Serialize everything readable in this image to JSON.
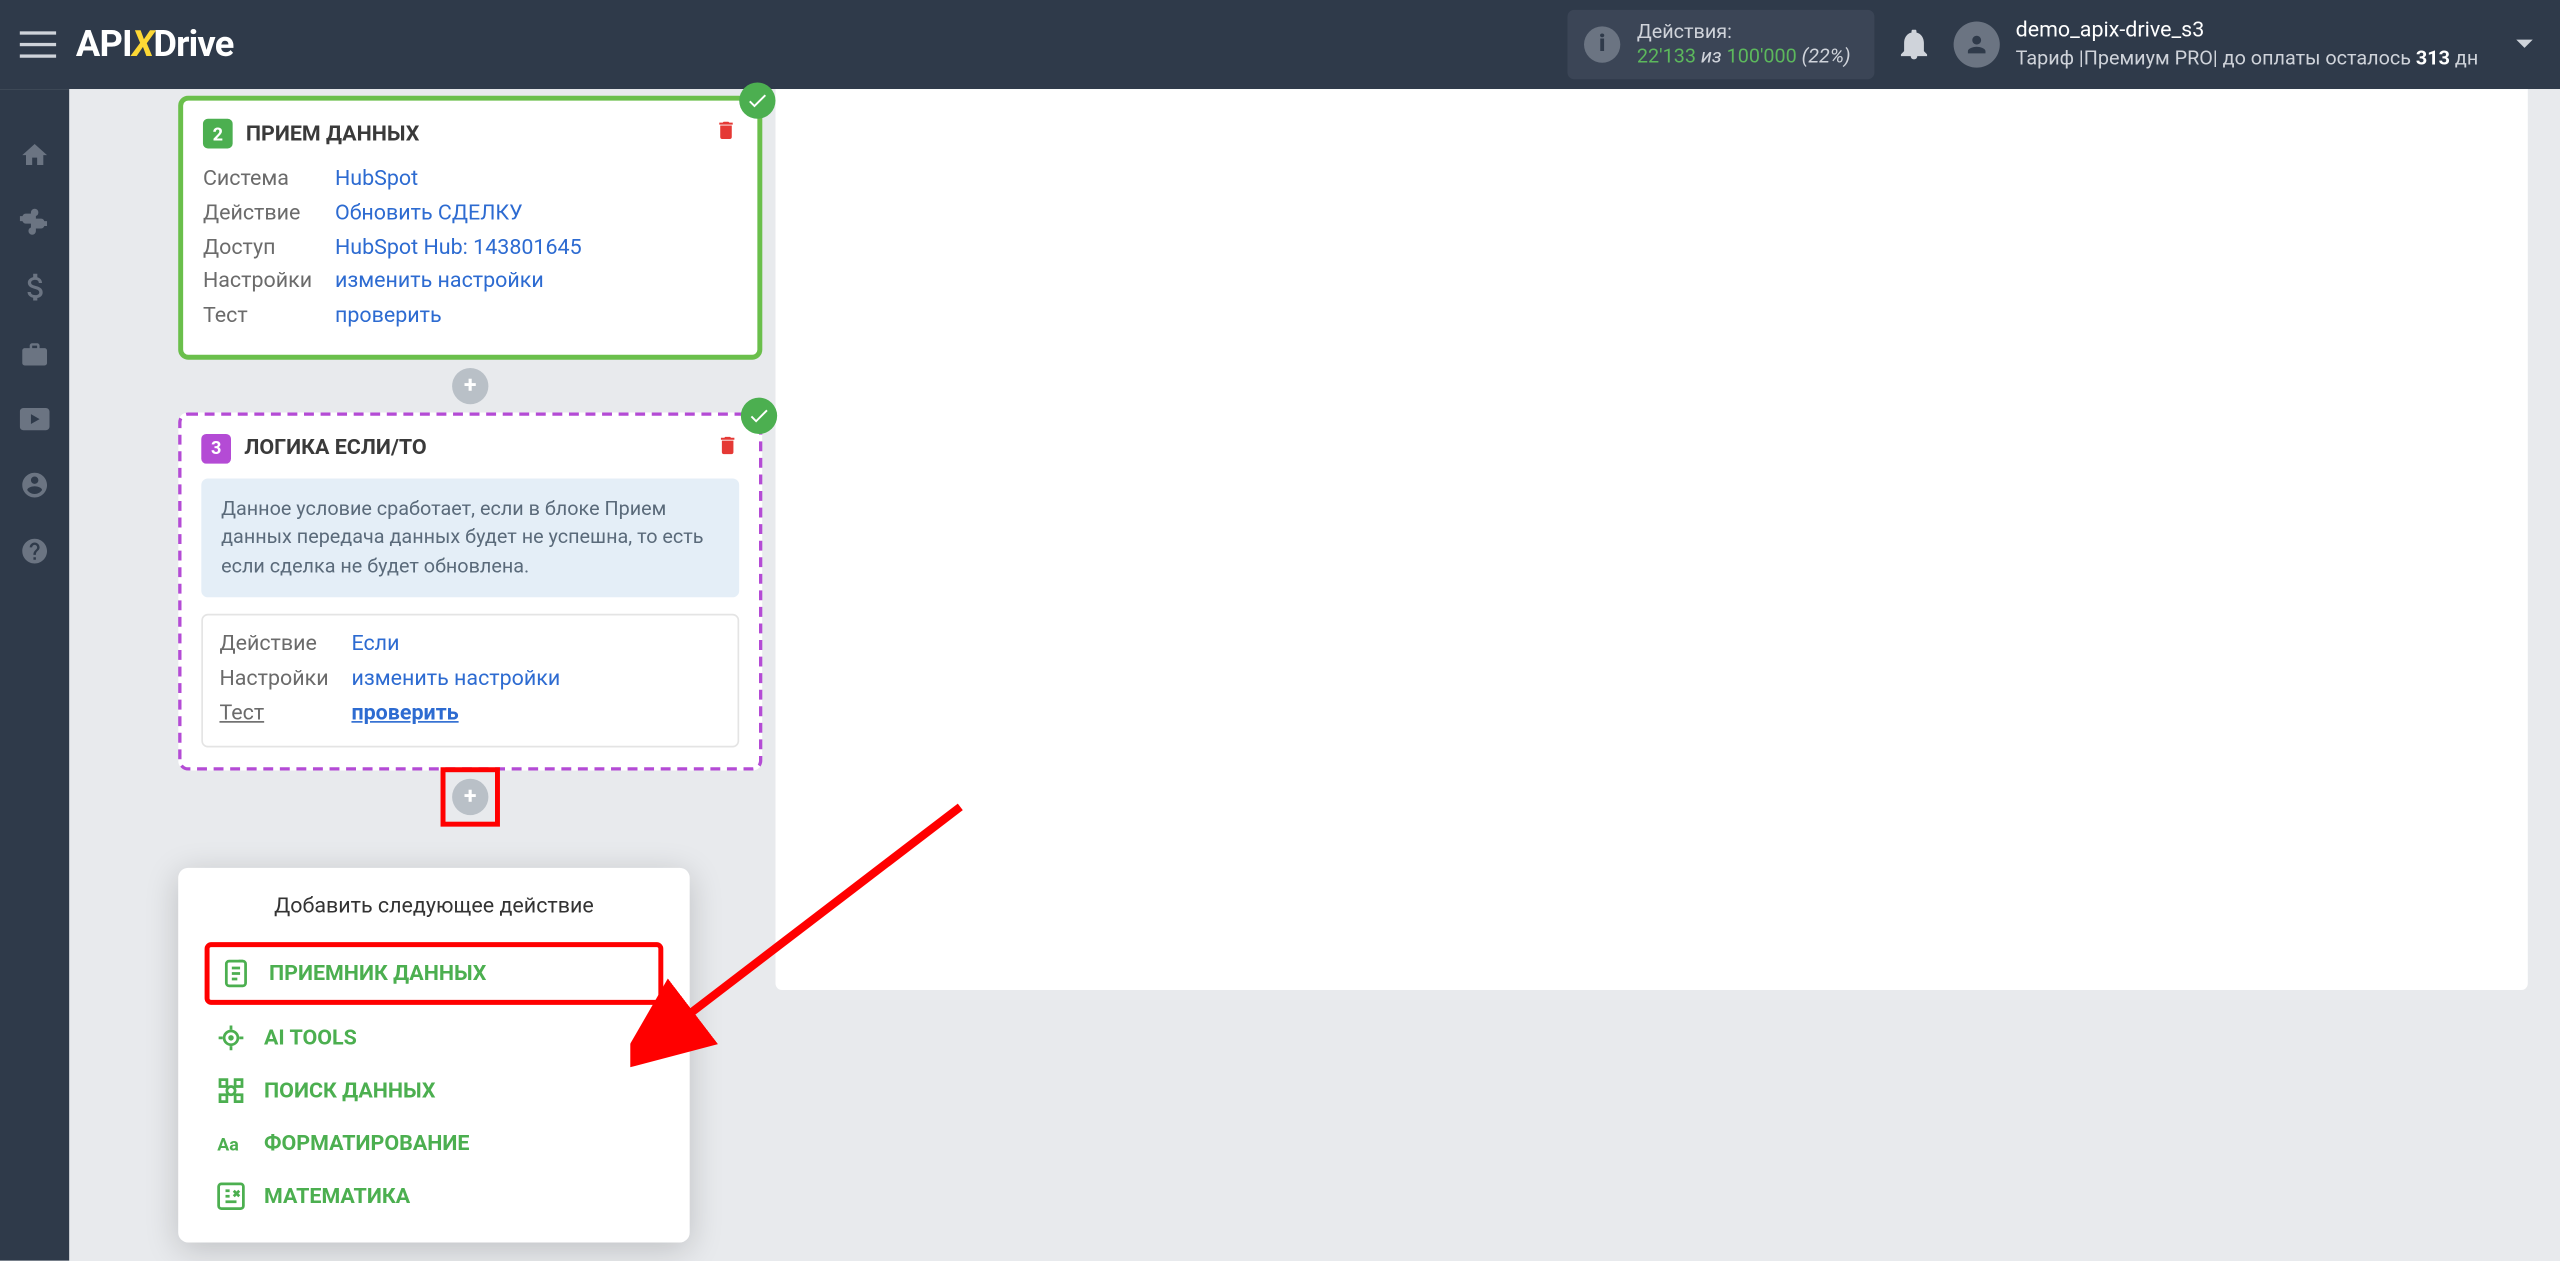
{
  "header": {
    "logo_part1": "API",
    "logo_part2": "X",
    "logo_part3": "Drive",
    "actions_label": "Действия:",
    "actions_used": "22'133",
    "actions_iz": "из",
    "actions_total": "100'000",
    "actions_percent": "(22%)",
    "username": "demo_apix-drive_s3",
    "tariff_prefix": "Тариф |Премиум PRO| до оплаты осталось ",
    "tariff_days": "313",
    "tariff_suffix": " дн"
  },
  "block2": {
    "step": "2",
    "title": "ПРИЕМ ДАННЫХ",
    "rows": {
      "system_label": "Система",
      "system_value": "HubSpot",
      "action_label": "Действие",
      "action_value": "Обновить СДЕЛКУ",
      "access_label": "Доступ",
      "access_value": "HubSpot Hub: 143801645",
      "settings_label": "Настройки",
      "settings_value": "изменить настройки",
      "test_label": "Тест",
      "test_value": "проверить"
    }
  },
  "block3": {
    "step": "3",
    "title": "ЛОГИКА ЕСЛИ/ТО",
    "description": "Данное условие сработает, если в блоке Прием данных передача данных будет не успешна, то есть если сделка не будет обновлена.",
    "rows": {
      "action_label": "Действие",
      "action_value": "Если",
      "settings_label": "Настройки",
      "settings_value": "изменить настройки",
      "test_label": "Тест",
      "test_value": "проверить"
    }
  },
  "popup": {
    "title": "Добавить следующее действие",
    "options": [
      "ПРИЕМНИК ДАННЫХ",
      "AI TOOLS",
      "ПОИСК ДАННЫХ",
      "ФОРМАТИРОВАНИЕ",
      "МАТЕМАТИКА"
    ]
  }
}
